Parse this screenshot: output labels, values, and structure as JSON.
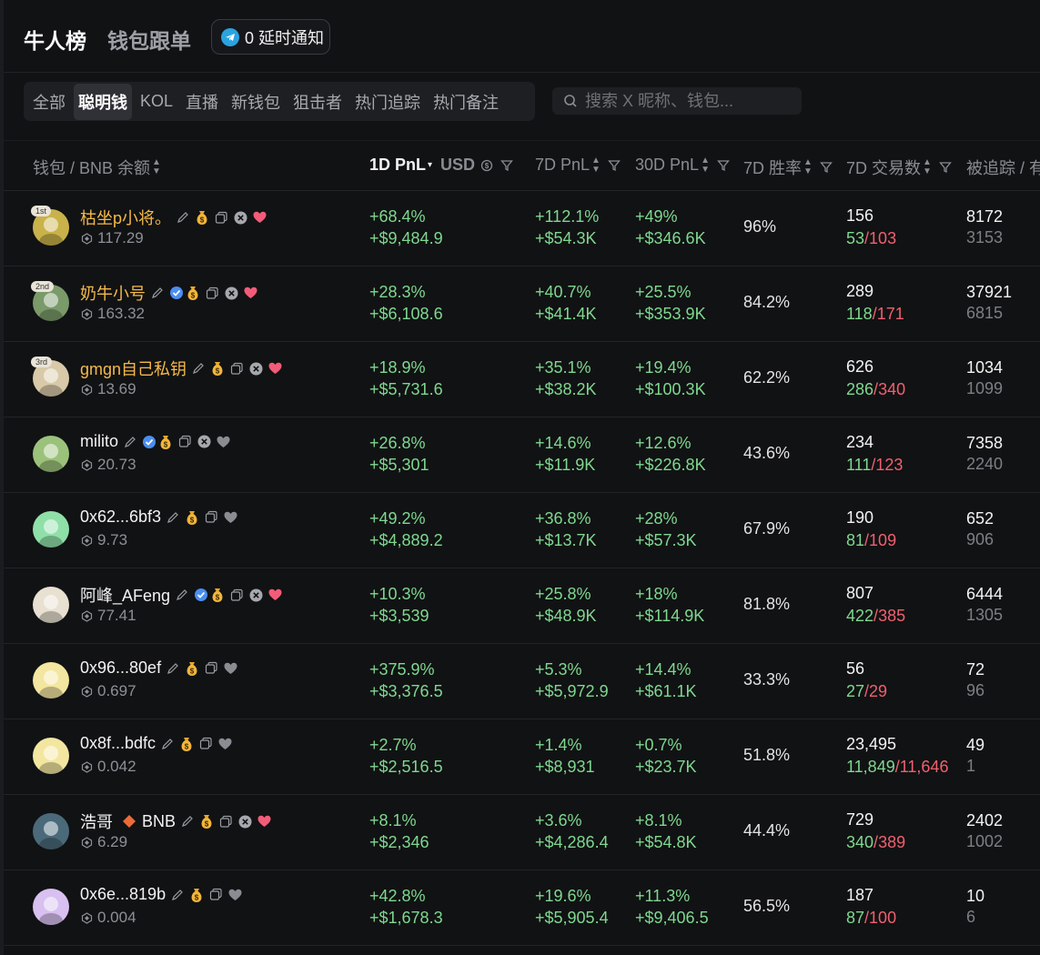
{
  "header": {
    "title": "牛人榜",
    "subtitle": "钱包跟单",
    "notify": "0 延时通知"
  },
  "tabs": [
    {
      "label": "全部"
    },
    {
      "label": "聪明钱",
      "active": true
    },
    {
      "label": "KOL"
    },
    {
      "label": "直播"
    },
    {
      "label": "新钱包"
    },
    {
      "label": "狙击者"
    },
    {
      "label": "热门追踪"
    },
    {
      "label": "热门备注"
    }
  ],
  "search": {
    "placeholder": "搜索 X 昵称、钱包..."
  },
  "columns": {
    "wallet": "钱包 / BNB 余额",
    "pnl1d": "1D PnL",
    "currency": "USD",
    "pnl7d": "7D PnL",
    "pnl30d": "30D PnL",
    "winrate": "7D 胜率",
    "tx7d": "7D 交易数",
    "followed": "被追踪 / 有"
  },
  "rows": [
    {
      "rank": "1st",
      "name": "枯坐p小将。",
      "gold": true,
      "verified": false,
      "x": true,
      "heart": true,
      "balance": "117.29",
      "p1": "+68.4%",
      "u1": "+$9,484.9",
      "p7": "+112.1%",
      "u7": "+$54.3K",
      "p30": "+49%",
      "u30": "+$346.6K",
      "winrate": "96%",
      "tx": "156",
      "buy": "53",
      "sell": "103",
      "f1": "8172",
      "f2": "3153",
      "av": "#c9b24a"
    },
    {
      "rank": "2nd",
      "name": "奶牛小号",
      "gold": true,
      "verified": true,
      "x": true,
      "heart": true,
      "balance": "163.32",
      "p1": "+28.3%",
      "u1": "+$6,108.6",
      "p7": "+40.7%",
      "u7": "+$41.4K",
      "p30": "+25.5%",
      "u30": "+$353.9K",
      "winrate": "84.2%",
      "tx": "289",
      "buy": "118",
      "sell": "171",
      "f1": "37921",
      "f2": "6815",
      "av": "#7a9a6a"
    },
    {
      "rank": "3rd",
      "name": "gmgn自己私钥",
      "gold": true,
      "verified": false,
      "x": true,
      "heart": true,
      "balance": "13.69",
      "p1": "+18.9%",
      "u1": "+$5,731.6",
      "p7": "+35.1%",
      "u7": "+$38.2K",
      "p30": "+19.4%",
      "u30": "+$100.3K",
      "winrate": "62.2%",
      "tx": "626",
      "buy": "286",
      "sell": "340",
      "f1": "1034",
      "f2": "1099",
      "av": "#d8c9a8"
    },
    {
      "rank": "",
      "name": "milito",
      "gold": false,
      "verified": true,
      "x": true,
      "heart": false,
      "balance": "20.73",
      "p1": "+26.8%",
      "u1": "+$5,301",
      "p7": "+14.6%",
      "u7": "+$11.9K",
      "p30": "+12.6%",
      "u30": "+$226.8K",
      "winrate": "43.6%",
      "tx": "234",
      "buy": "111",
      "sell": "123",
      "f1": "7358",
      "f2": "2240",
      "av": "#9bc27a"
    },
    {
      "rank": "",
      "name": "0x62...6bf3",
      "gold": false,
      "verified": false,
      "x": false,
      "heart": false,
      "balance": "9.73",
      "p1": "+49.2%",
      "u1": "+$4,889.2",
      "p7": "+36.8%",
      "u7": "+$13.7K",
      "p30": "+28%",
      "u30": "+$57.3K",
      "winrate": "67.9%",
      "tx": "190",
      "buy": "81",
      "sell": "109",
      "f1": "652",
      "f2": "906",
      "av": "#8fe0a8"
    },
    {
      "rank": "",
      "name": "阿峰_AFeng",
      "gold": false,
      "verified": true,
      "x": true,
      "heart": true,
      "balance": "77.41",
      "p1": "+10.3%",
      "u1": "+$3,539",
      "p7": "+25.8%",
      "u7": "+$48.9K",
      "p30": "+18%",
      "u30": "+$114.9K",
      "winrate": "81.8%",
      "tx": "807",
      "buy": "422",
      "sell": "385",
      "f1": "6444",
      "f2": "1305",
      "av": "#e8e0d0"
    },
    {
      "rank": "",
      "name": "0x96...80ef",
      "gold": false,
      "verified": false,
      "x": false,
      "heart": false,
      "balance": "0.697",
      "p1": "+375.9%",
      "u1": "+$3,376.5",
      "p7": "+5.3%",
      "u7": "+$5,972.9",
      "p30": "+14.4%",
      "u30": "+$61.1K",
      "winrate": "33.3%",
      "tx": "56",
      "buy": "27",
      "sell": "29",
      "f1": "72",
      "f2": "96",
      "av": "#f3e6a0"
    },
    {
      "rank": "",
      "name": "0x8f...bdfc",
      "gold": false,
      "verified": false,
      "x": false,
      "heart": false,
      "balance": "0.042",
      "p1": "+2.7%",
      "u1": "+$2,516.5",
      "p7": "+1.4%",
      "u7": "+$8,931",
      "p30": "+0.7%",
      "u30": "+$23.7K",
      "winrate": "51.8%",
      "tx": "23,495",
      "buy": "11,849",
      "sell": "11,646",
      "f1": "49",
      "f2": "1",
      "av": "#f3e6a0"
    },
    {
      "rank": "",
      "name": "浩哥",
      "bnb": "BNB",
      "gold": false,
      "verified": false,
      "x": true,
      "heart": true,
      "balance": "6.29",
      "p1": "+8.1%",
      "u1": "+$2,346",
      "p7": "+3.6%",
      "u7": "+$4,286.4",
      "p30": "+8.1%",
      "u30": "+$54.8K",
      "winrate": "44.4%",
      "tx": "729",
      "buy": "340",
      "sell": "389",
      "f1": "2402",
      "f2": "1002",
      "av": "#4a6a7a"
    },
    {
      "rank": "",
      "name": "0x6e...819b",
      "gold": false,
      "verified": false,
      "x": false,
      "heart": false,
      "balance": "0.004",
      "p1": "+42.8%",
      "u1": "+$1,678.3",
      "p7": "+19.6%",
      "u7": "+$5,905.4",
      "p30": "+11.3%",
      "u30": "+$9,406.5",
      "winrate": "56.5%",
      "tx": "187",
      "buy": "87",
      "sell": "100",
      "f1": "10",
      "f2": "6",
      "av": "#d8c0f0"
    }
  ],
  "colors": {
    "green": "#7fd88f",
    "red": "#f0606e",
    "gold": "#f5b94a",
    "heart": "#f25c78"
  }
}
